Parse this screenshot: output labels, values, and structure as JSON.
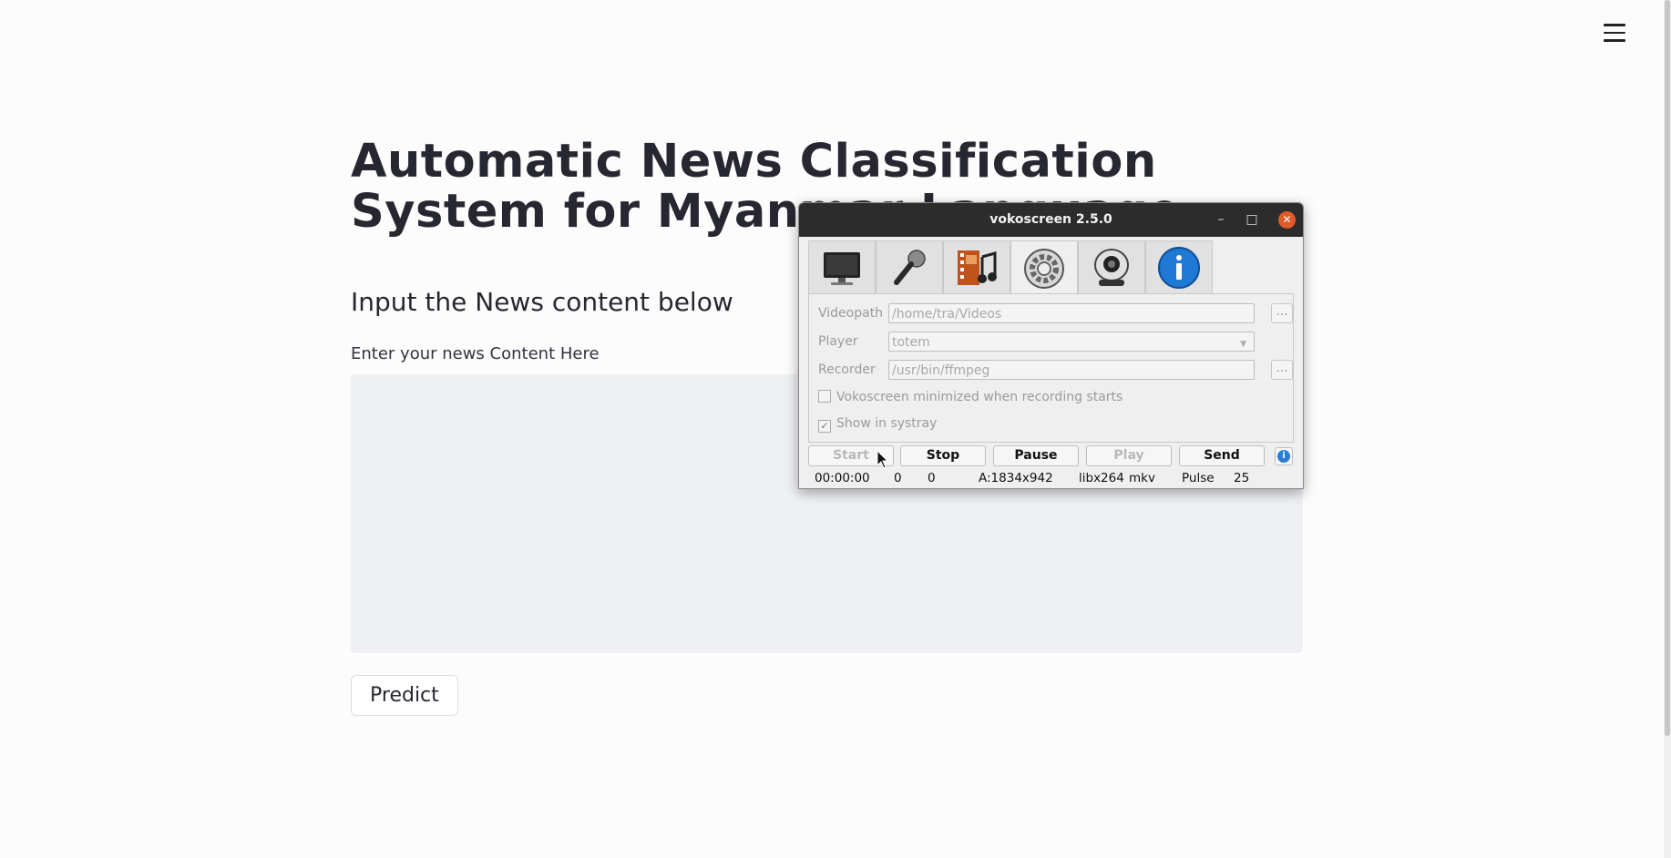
{
  "page": {
    "title": "Automatic News Classification System for Myanmar Language",
    "subheader": "Input the News content below",
    "input_label": "Enter your news Content Here",
    "textarea_value": "",
    "predict_label": "Predict",
    "menu_icon": "hamburger-menu-icon"
  },
  "vokoscreen": {
    "window_title": "vokoscreen 2.5.0",
    "tabs": [
      {
        "icon": "monitor-icon"
      },
      {
        "icon": "microphone-icon"
      },
      {
        "icon": "film-music-icon"
      },
      {
        "icon": "settings-gear-icon"
      },
      {
        "icon": "webcam-icon"
      },
      {
        "icon": "info-icon"
      }
    ],
    "videopath_label": "Videopath",
    "videopath_value": "/home/tra/Videos",
    "player_label": "Player",
    "player_value": "totem",
    "recorder_label": "Recorder",
    "recorder_value": "/usr/bin/ffmpeg",
    "browse_label": "...",
    "minimized_label": "Vokoscreen minimized when recording starts",
    "systray_label": "Show in systray",
    "minimized_checked": false,
    "systray_checked": true,
    "buttons": {
      "start": "Start",
      "stop": "Stop",
      "pause": "Pause",
      "play": "Play",
      "send": "Send"
    },
    "status": {
      "time": "00:00:00",
      "frames": "0",
      "fps": "0",
      "area": "A:1834x942",
      "codec": "libx264",
      "format": "mkv",
      "audio": "Pulse",
      "rate": "25"
    },
    "info_icon": "i"
  }
}
